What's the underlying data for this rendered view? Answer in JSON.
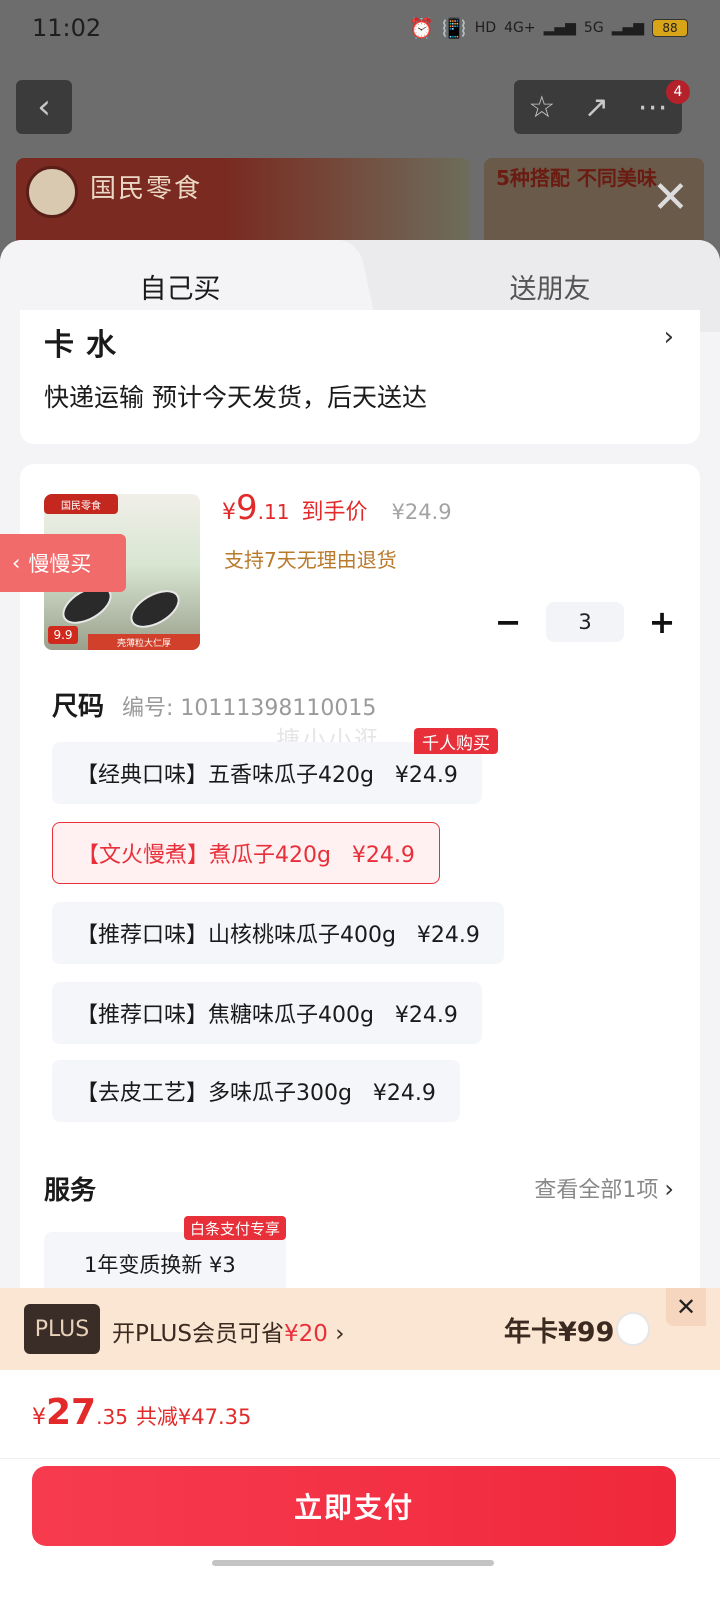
{
  "status_bar": {
    "time": "11:02",
    "network_1": "4G+",
    "network_2": "5G",
    "hd": "HD",
    "battery": "88"
  },
  "nav": {
    "badge": "4"
  },
  "background": {
    "brand": "国民零食",
    "banner_text": "5种搭配 不同美味"
  },
  "tabs": {
    "self": "自己买",
    "gift": "送朋友"
  },
  "address": {
    "name": "卡水",
    "delivery": "快递运输 预计今天发货，后天送达"
  },
  "product": {
    "slow_buy": "慢慢买",
    "price_currency": "¥",
    "price_int": "9",
    "price_dec": ".11",
    "price_label": "到手价",
    "original_price": "¥24.9",
    "return_policy": "支持7天无理由退货",
    "quantity": "3",
    "image_tag": "国民零食",
    "image_price": "9.9",
    "image_strip": "壳薄粒大仁厚"
  },
  "size": {
    "title": "尺码",
    "code": "编号: 10111398110015",
    "watermark": "搪小小逛",
    "options": [
      {
        "label": "【经典口味】五香味瓜子420g   ¥24.9",
        "badge": "千人购买"
      },
      {
        "label": "【文火慢煮】煮瓜子420g   ¥24.9"
      },
      {
        "label": "【推荐口味】山核桃味瓜子400g   ¥24.9"
      },
      {
        "label": "【推荐口味】焦糖味瓜子400g   ¥24.9"
      },
      {
        "label": "【去皮工艺】多味瓜子300g   ¥24.9"
      }
    ],
    "selected_index": 1
  },
  "service": {
    "title": "服务",
    "view_all": "查看全部1项",
    "option": "1年变质换新  ¥3",
    "badge": "白条支付专享"
  },
  "plus": {
    "logo": "PLUS",
    "text": "开PLUS会员可省",
    "save": "¥20",
    "year_card": "年卡¥99"
  },
  "footer": {
    "currency": "¥",
    "total_int": "27",
    "total_dec": ".35",
    "reduce": "共减¥47.35",
    "pay": "立即支付"
  },
  "colors": {
    "accent": "#e8303a",
    "gold": "#b97a2c",
    "plus_bg": "#fbe5d3"
  }
}
